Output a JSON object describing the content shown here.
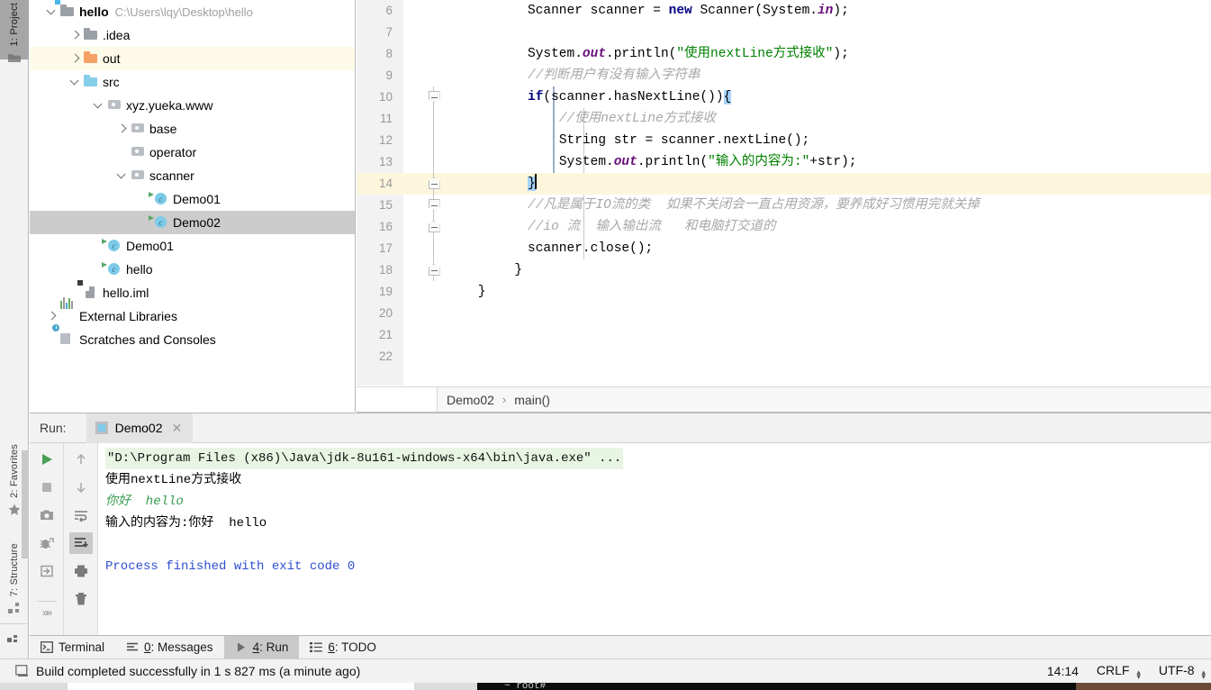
{
  "window": {
    "left_tool_tabs": [
      {
        "label": "1: Project",
        "icon": "folder-icon",
        "active": true
      },
      {
        "label": "2: Favorites",
        "icon": "star-icon",
        "active": false
      },
      {
        "label": "7: Structure",
        "icon": "structure-icon",
        "active": false
      }
    ]
  },
  "sidebar": {
    "tree": [
      {
        "depth": 0,
        "arrow": "down",
        "icon": "project-folder-icon",
        "label": "hello",
        "bold": true,
        "path": "C:\\Users\\lqy\\Desktop\\hello",
        "state": "normal"
      },
      {
        "depth": 1,
        "arrow": "right",
        "icon": "folder-gray-icon",
        "label": ".idea",
        "bold": false,
        "path": "",
        "state": "normal"
      },
      {
        "depth": 1,
        "arrow": "right",
        "icon": "folder-orange-icon",
        "label": "out",
        "bold": false,
        "path": "",
        "state": "highlight"
      },
      {
        "depth": 1,
        "arrow": "down",
        "icon": "folder-blue-icon",
        "label": "src",
        "bold": false,
        "path": "",
        "state": "normal"
      },
      {
        "depth": 2,
        "arrow": "down",
        "icon": "package-icon",
        "label": "xyz.yueka.www",
        "bold": false,
        "path": "",
        "state": "normal"
      },
      {
        "depth": 3,
        "arrow": "right",
        "icon": "package-icon",
        "label": "base",
        "bold": false,
        "path": "",
        "state": "normal"
      },
      {
        "depth": 3,
        "arrow": "none",
        "icon": "package-icon",
        "label": "operator",
        "bold": false,
        "path": "",
        "state": "normal"
      },
      {
        "depth": 3,
        "arrow": "down",
        "icon": "package-icon",
        "label": "scanner",
        "bold": false,
        "path": "",
        "state": "normal"
      },
      {
        "depth": 4,
        "arrow": "none",
        "icon": "java-class-icon",
        "label": "Demo01",
        "bold": false,
        "path": "",
        "state": "normal"
      },
      {
        "depth": 4,
        "arrow": "none",
        "icon": "java-class-icon",
        "label": "Demo02",
        "bold": false,
        "path": "",
        "state": "selected"
      },
      {
        "depth": 2,
        "arrow": "none",
        "icon": "java-class-icon",
        "label": "Demo01",
        "bold": false,
        "path": "",
        "state": "normal"
      },
      {
        "depth": 2,
        "arrow": "none",
        "icon": "java-class-icon",
        "label": "hello",
        "bold": false,
        "path": "",
        "state": "normal"
      },
      {
        "depth": 1,
        "arrow": "none",
        "icon": "iml-file-icon",
        "label": "hello.iml",
        "bold": false,
        "path": "",
        "state": "normal"
      },
      {
        "depth": 0,
        "arrow": "right",
        "icon": "libraries-icon",
        "label": "External Libraries",
        "bold": false,
        "path": "",
        "state": "normal"
      },
      {
        "depth": 0,
        "arrow": "none",
        "icon": "scratches-icon",
        "label": "Scratches and Consoles",
        "bold": false,
        "path": "",
        "state": "normal"
      }
    ]
  },
  "editor": {
    "first_line_number": 6,
    "current_line": 14,
    "lines": [
      {
        "n": 6,
        "indent": 2,
        "tokens": [
          {
            "t": "Scanner scanner = ",
            "c": ""
          },
          {
            "t": "new",
            "c": "kw"
          },
          {
            "t": " Scanner(System.",
            "c": ""
          },
          {
            "t": "in",
            "c": "fld"
          },
          {
            "t": ");",
            "c": ""
          }
        ]
      },
      {
        "n": 7,
        "indent": 2,
        "tokens": []
      },
      {
        "n": 8,
        "indent": 2,
        "tokens": [
          {
            "t": "System.",
            "c": ""
          },
          {
            "t": "out",
            "c": "fld"
          },
          {
            "t": ".println(",
            "c": ""
          },
          {
            "t": "\"使用nextLine方式接收\"",
            "c": "str"
          },
          {
            "t": ");",
            "c": ""
          }
        ]
      },
      {
        "n": 9,
        "indent": 2,
        "tokens": [
          {
            "t": "//判断用户有没有输入字符串",
            "c": "cmt"
          }
        ]
      },
      {
        "n": 10,
        "indent": 2,
        "tokens": [
          {
            "t": "if",
            "c": "kw"
          },
          {
            "t": "(scanner.hasNextLine())",
            "c": ""
          },
          {
            "t": "{",
            "c": "sel"
          }
        ]
      },
      {
        "n": 11,
        "indent": 3,
        "tokens": [
          {
            "t": "//使用nextLine方式接收",
            "c": "cmt"
          }
        ]
      },
      {
        "n": 12,
        "indent": 3,
        "tokens": [
          {
            "t": "String str = scanner.nextLine();",
            "c": ""
          }
        ]
      },
      {
        "n": 13,
        "indent": 3,
        "tokens": [
          {
            "t": "System.",
            "c": ""
          },
          {
            "t": "out",
            "c": "fld"
          },
          {
            "t": ".println(",
            "c": ""
          },
          {
            "t": "\"输入的内容为:\"",
            "c": "str"
          },
          {
            "t": "+str);",
            "c": ""
          }
        ]
      },
      {
        "n": 14,
        "indent": 2,
        "tokens": [
          {
            "t": "}",
            "c": "sel"
          },
          {
            "t": "",
            "c": "caret"
          }
        ]
      },
      {
        "n": 15,
        "indent": 2,
        "tokens": [
          {
            "t": "//凡是属于IO流的类  如果不关闭会一直占用资源，要养成好习惯用完就关掉",
            "c": "cmt"
          }
        ]
      },
      {
        "n": 16,
        "indent": 2,
        "tokens": [
          {
            "t": "//io 流  输入输出流   和电脑打交道的",
            "c": "cmt"
          }
        ]
      },
      {
        "n": 17,
        "indent": 2,
        "tokens": [
          {
            "t": "scanner.close();",
            "c": ""
          }
        ]
      },
      {
        "n": 18,
        "indent": 1,
        "tokens": [
          {
            "t": "}",
            "c": ""
          }
        ]
      },
      {
        "n": 19,
        "indent": 0,
        "tokens": [
          {
            "t": "}",
            "c": ""
          }
        ]
      },
      {
        "n": 20,
        "indent": 0,
        "tokens": []
      },
      {
        "n": 21,
        "indent": 0,
        "tokens": []
      },
      {
        "n": 22,
        "indent": 0,
        "tokens": []
      }
    ],
    "fold_markers": [
      {
        "line": 10,
        "type": "down"
      },
      {
        "line": 14,
        "type": "up"
      },
      {
        "line": 15,
        "type": "down"
      },
      {
        "line": 16,
        "type": "up"
      },
      {
        "line": 18,
        "type": "up"
      }
    ]
  },
  "breadcrumb": {
    "class": "Demo02",
    "separator": "›",
    "method": "main()"
  },
  "run_window": {
    "label": "Run:",
    "tab_title": "Demo02",
    "close_glyph": "✕",
    "toolbar_left": [
      {
        "name": "rerun-button",
        "icon": "play-icon"
      },
      {
        "name": "stop-button",
        "icon": "stop-icon"
      },
      {
        "name": "screenshot-button",
        "icon": "camera-icon"
      },
      {
        "name": "debug-attach-button",
        "icon": "bug-icon"
      },
      {
        "name": "export-button",
        "icon": "import-arrow-icon"
      },
      {
        "name": "expand-toolbar-button",
        "icon": "chevrons-right-icon"
      }
    ],
    "toolbar_right": [
      {
        "name": "up-button",
        "icon": "arrow-up-icon",
        "active": false
      },
      {
        "name": "down-button",
        "icon": "arrow-down-icon",
        "active": false
      },
      {
        "name": "soft-wrap-button",
        "icon": "wrap-icon",
        "active": false
      },
      {
        "name": "scroll-to-end-button",
        "icon": "scroll-end-icon",
        "active": true
      },
      {
        "name": "print-button",
        "icon": "printer-icon",
        "active": false
      },
      {
        "name": "clear-all-button",
        "icon": "trash-icon",
        "active": false
      }
    ],
    "console_lines": [
      {
        "text": "\"D:\\Program Files (x86)\\Java\\jdk-8u161-windows-x64\\bin\\java.exe\" ...",
        "style": "cmd"
      },
      {
        "text": "使用nextLine方式接收",
        "style": "plain"
      },
      {
        "text": "你好  hello",
        "style": "input"
      },
      {
        "text": "输入的内容为:你好  hello",
        "style": "plain"
      },
      {
        "text": "",
        "style": "plain"
      },
      {
        "text": "Process finished with exit code 0",
        "style": "exit"
      }
    ]
  },
  "bottom_bar": {
    "buttons": [
      {
        "label": "Terminal",
        "accel": "",
        "icon": "terminal-icon",
        "active": false
      },
      {
        "label": ": Messages",
        "accel": "0",
        "icon": "messages-icon",
        "active": false
      },
      {
        "label": ": Run",
        "accel": "4",
        "icon": "play-small-icon",
        "active": true
      },
      {
        "label": ": TODO",
        "accel": "6",
        "icon": "todo-list-icon",
        "active": false
      }
    ]
  },
  "status_bar": {
    "icon": "build-icon",
    "message": "Build completed successfully in 1 s 827 ms (a minute ago)",
    "time": "14:14",
    "line_separator": "CRLF",
    "encoding": "UTF-8"
  },
  "desktop": {
    "terminal_prompt": "~ root#"
  },
  "colors": {
    "keyword": "#000080",
    "string": "#008000",
    "comment": "#a8a8a8",
    "field": "#660e7a",
    "selection": "#a6d2ff",
    "current_line": "#fdf6dd",
    "tree_selection": "#cccccc"
  }
}
